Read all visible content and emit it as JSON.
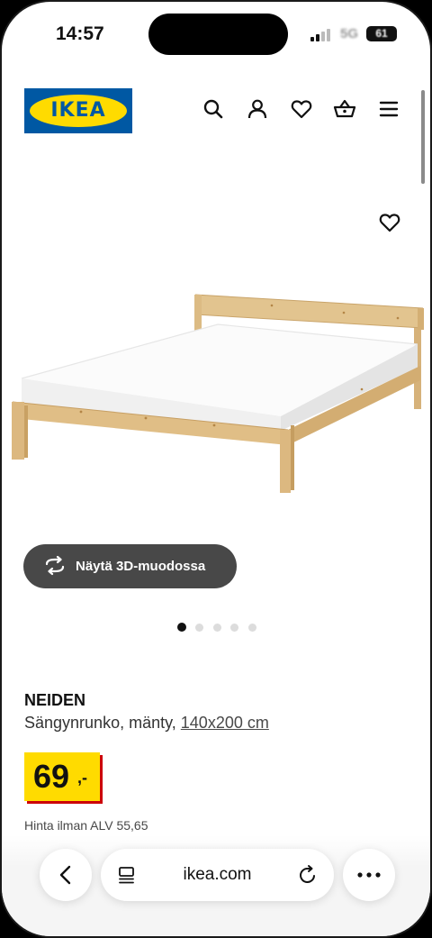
{
  "status_bar": {
    "time": "14:57",
    "network": "5G",
    "battery": "61"
  },
  "header": {
    "logo_text": "IKEA",
    "icons": [
      "search-icon",
      "account-icon",
      "wishlist-icon",
      "basket-icon",
      "menu-icon"
    ]
  },
  "product": {
    "view_3d_label": "Näytä 3D-muodossa",
    "image_count": 5,
    "active_image": 1,
    "name": "NEIDEN",
    "description": "Sängynrunko, mänty,",
    "size_link": "140x200 cm",
    "price": "69",
    "price_suffix": ",-",
    "vat_text": "Hinta ilman ALV 55,65"
  },
  "browser": {
    "url": "ikea.com"
  },
  "colors": {
    "ikea_blue": "#0058a3",
    "ikea_yellow": "#ffdb00",
    "price_red": "#cc0008",
    "button_dark": "#484848"
  }
}
